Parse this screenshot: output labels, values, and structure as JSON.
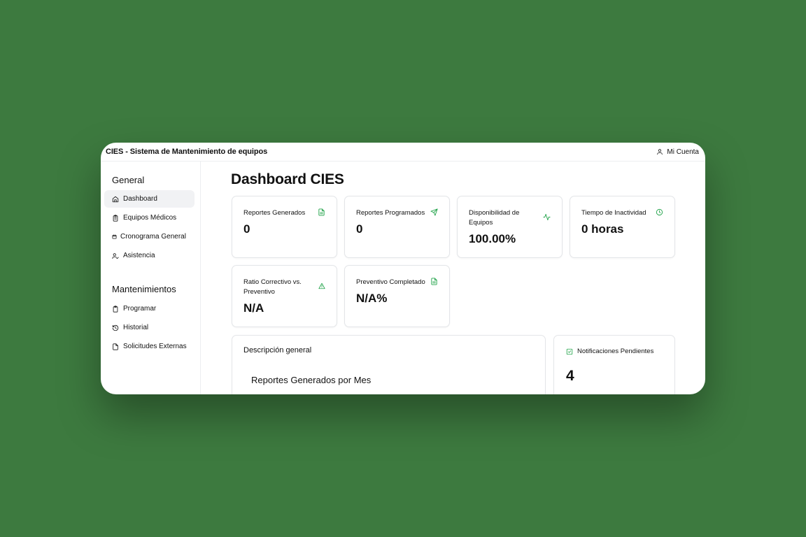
{
  "header": {
    "app_title": "CIES - Sistema de Mantenimiento de equipos",
    "account_label": "Mi Cuenta",
    "account_icon": "user-icon"
  },
  "sidebar": {
    "sections": [
      {
        "title": "General",
        "items": [
          {
            "label": "Dashboard",
            "icon": "home-icon",
            "active": true
          },
          {
            "label": "Equipos Médicos",
            "icon": "clipboard-list-icon"
          },
          {
            "label": "Cronograma General",
            "icon": "calendar-icon"
          },
          {
            "label": "Asistencia",
            "icon": "user-check-icon"
          }
        ]
      },
      {
        "title": "Mantenimientos",
        "items": [
          {
            "label": "Programar",
            "icon": "clipboard-icon"
          },
          {
            "label": "Historial",
            "icon": "history-icon"
          },
          {
            "label": "Solicitudes Externas",
            "icon": "file-icon"
          }
        ]
      }
    ]
  },
  "main": {
    "page_title": "Dashboard CIES",
    "cards": [
      {
        "label": "Reportes Generados",
        "value": "0",
        "icon": "file-text-icon"
      },
      {
        "label": "Reportes Programados",
        "value": "0",
        "icon": "send-icon"
      },
      {
        "label": "Disponibilidad de Equipos",
        "value": "100.00%",
        "icon": "activity-icon"
      },
      {
        "label": "Tiempo de Inactividad",
        "value": "0 horas",
        "icon": "clock-icon"
      },
      {
        "label": "Ratio Correctivo vs. Preventivo",
        "value": "N/A",
        "icon": "alert-triangle-icon"
      },
      {
        "label": "Preventivo Completado",
        "value": "N/A%",
        "icon": "file-text-icon"
      }
    ],
    "overview": {
      "title": "Descripción general",
      "chart_title": "Reportes Generados por Mes"
    },
    "notifications": {
      "title": "Notificaciones Pendientes",
      "count": "4",
      "icon": "check-square-icon"
    }
  },
  "colors": {
    "background": "#3d7a3f",
    "accent": "#22a34a",
    "border": "#e3e5e8",
    "active_nav": "#f1f2f4"
  }
}
